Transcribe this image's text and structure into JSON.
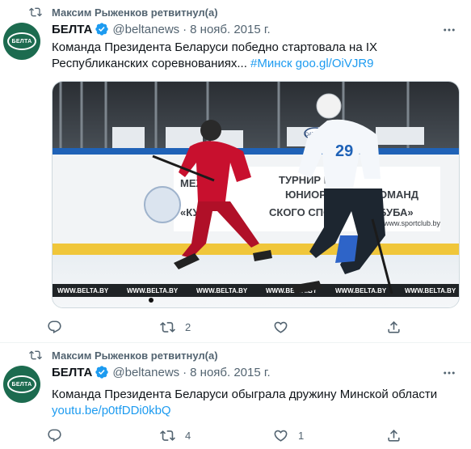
{
  "colors": {
    "accent": "#1d9bf0",
    "secondary_text": "#536471",
    "avatar_bg": "#1c6b4f"
  },
  "tweets": [
    {
      "retweet_label": "Максим Рыженков ретвитнул(а)",
      "author_name": "БЕЛТА",
      "avatar_logo": "БЕЛТА",
      "handle": "@beltanews",
      "separator": "·",
      "date": "8 нояб. 2015 г.",
      "text": "Команда Президента Беларуси победно стартовала на IX Республиканских соревнованиях... ",
      "hashtag": "#Минск",
      "link": "goo.gl/OiVJR9",
      "media": {
        "banner_lines": [
          "МЕЖ",
          "ТУРНИР ПО Х",
          "ЮНИОРСК",
          "ОМАНД",
          "«КУБ",
          "СКОГО СПО",
          "БУБА»"
        ],
        "site": "www.sportclub.by",
        "watermark": "WWW.BELTA.BY",
        "jersey_number": "29",
        "stick_brand": "PRONNING",
        "sign": "DATSUN"
      },
      "actions": {
        "reply_count": "",
        "retweet_count": "2",
        "like_count": ""
      }
    },
    {
      "retweet_label": "Максим Рыженков ретвитнул(а)",
      "author_name": "БЕЛТА",
      "avatar_logo": "БЕЛТА",
      "handle": "@beltanews",
      "separator": "·",
      "date": "8 нояб. 2015 г.",
      "text": "Команда Президента Беларуси обыграла дружину Минской области ",
      "link": "youtu.be/p0tfDDi0kbQ",
      "actions": {
        "reply_count": "",
        "retweet_count": "4",
        "like_count": "1"
      }
    }
  ]
}
